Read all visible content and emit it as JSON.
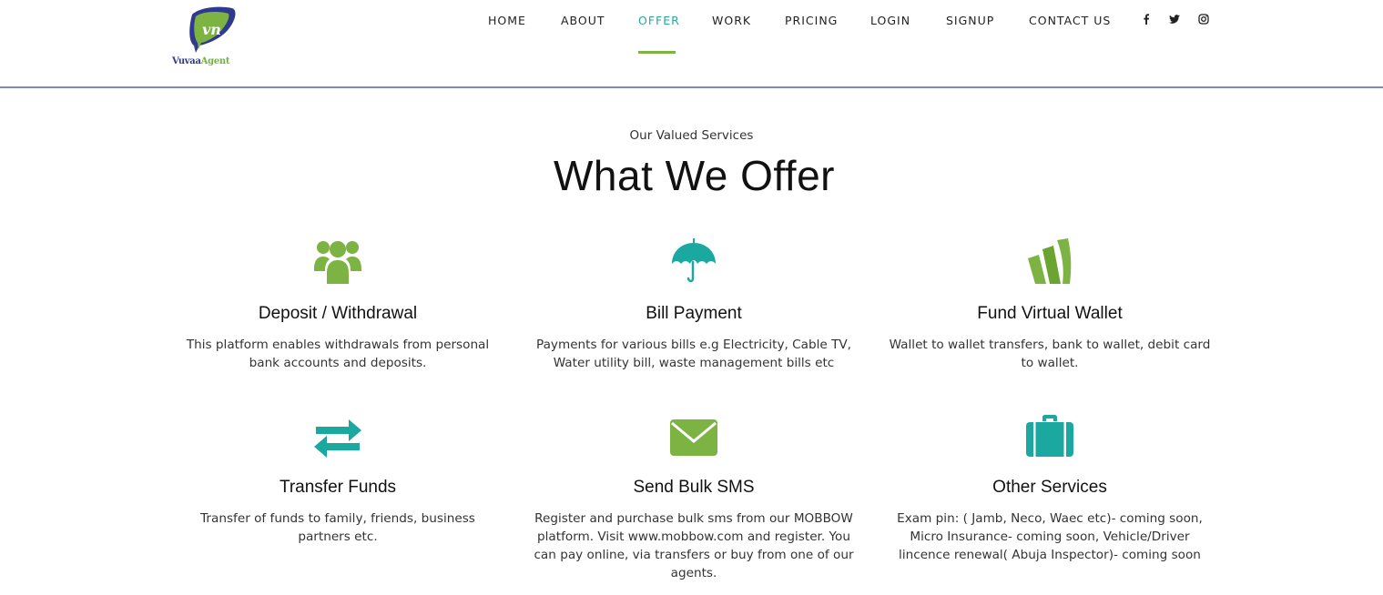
{
  "logo": {
    "text_part1": "Vuvaa",
    "text_part2": "Agent"
  },
  "nav": {
    "items": [
      {
        "label": "HOME"
      },
      {
        "label": "ABOUT"
      },
      {
        "label": "OFFER"
      },
      {
        "label": "WORK"
      },
      {
        "label": "PRICING"
      },
      {
        "label": "LOGIN"
      },
      {
        "label": "SIGNUP"
      },
      {
        "label": "CONTACT US"
      }
    ],
    "active": "OFFER",
    "social_icons": [
      "facebook-icon",
      "twitter-icon",
      "instagram-icon"
    ]
  },
  "section": {
    "subtitle": "Our Valued Services",
    "title": "What We Offer"
  },
  "services": [
    {
      "title": "Deposit / Withdrawal",
      "description": "This platform enables withdrawals from personal bank accounts and deposits.",
      "icon": "users-icon",
      "color": "#7cb342"
    },
    {
      "title": "Bill Payment",
      "description": "Payments for various bills e.g Electricity, Cable TV, Water utility bill, waste management bills etc",
      "icon": "umbrella-icon",
      "color": "#1aa8a0"
    },
    {
      "title": "Fund Virtual Wallet",
      "description": "Wallet to wallet transfers, bank to wallet, debit card to wallet.",
      "icon": "wallet-icon",
      "color": "#7cb342"
    },
    {
      "title": "Transfer Funds",
      "description": "Transfer of funds to family, friends, business partners etc.",
      "icon": "exchange-icon",
      "color": "#1aa8a0"
    },
    {
      "title": "Send Bulk SMS",
      "description": "Register and purchase bulk sms from our MOBBOW platform. Visit www.mobbow.com and register. You can pay online, via transfers or buy from one of our agents.",
      "icon": "envelope-icon",
      "color": "#7cb342"
    },
    {
      "title": "Other Services",
      "description": "Exam pin: ( Jamb, Neco, Waec etc)- coming soon, Micro Insurance- coming soon, Vehicle/Driver lincence renewal( Abuja Inspector)- coming soon",
      "icon": "briefcase-icon",
      "color": "#1aa8a0"
    }
  ],
  "colors": {
    "accent_teal": "#1aa8a0",
    "accent_green": "#7cb342",
    "header_border": "#7f86c0"
  }
}
